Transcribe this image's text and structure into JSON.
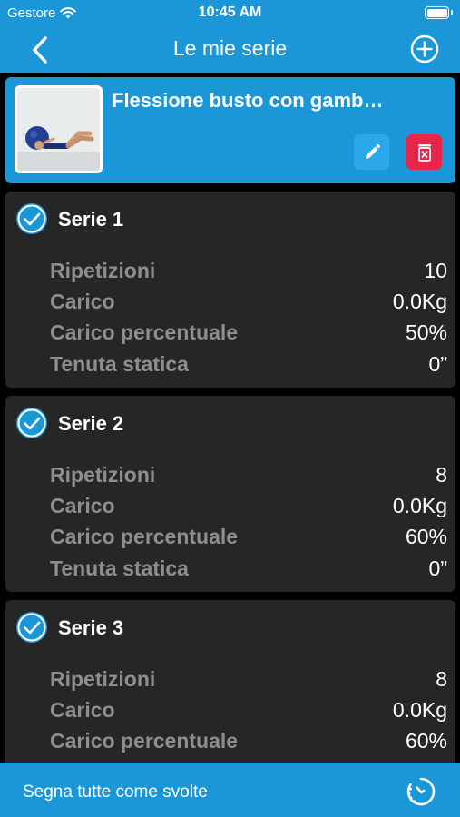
{
  "status_bar": {
    "carrier": "Gestore",
    "time": "10:45 AM"
  },
  "nav": {
    "title": "Le mie serie",
    "back_icon": "chevron-left-icon",
    "add_icon": "plus-circle-icon"
  },
  "exercise": {
    "name": "Flessione busto con gamb…"
  },
  "sets": [
    {
      "title": "Serie 1",
      "rows": [
        {
          "label": "Ripetizioni",
          "value": "10"
        },
        {
          "label": "Carico",
          "value": "0.0Kg"
        },
        {
          "label": "Carico percentuale",
          "value": "50%"
        },
        {
          "label": "Tenuta statica",
          "value": "0”"
        }
      ]
    },
    {
      "title": "Serie 2",
      "rows": [
        {
          "label": "Ripetizioni",
          "value": "8"
        },
        {
          "label": "Carico",
          "value": "0.0Kg"
        },
        {
          "label": "Carico percentuale",
          "value": "60%"
        },
        {
          "label": "Tenuta statica",
          "value": "0”"
        }
      ]
    },
    {
      "title": "Serie 3",
      "rows": [
        {
          "label": "Ripetizioni",
          "value": "8"
        },
        {
          "label": "Carico",
          "value": "0.0Kg"
        },
        {
          "label": "Carico percentuale",
          "value": "60%"
        }
      ]
    }
  ],
  "bottom_bar": {
    "mark_all": "Segna tutte come svolte"
  },
  "colors": {
    "accent": "#1b97d8",
    "delete": "#e8264a",
    "card": "#262626",
    "label": "#8e8e8e"
  }
}
